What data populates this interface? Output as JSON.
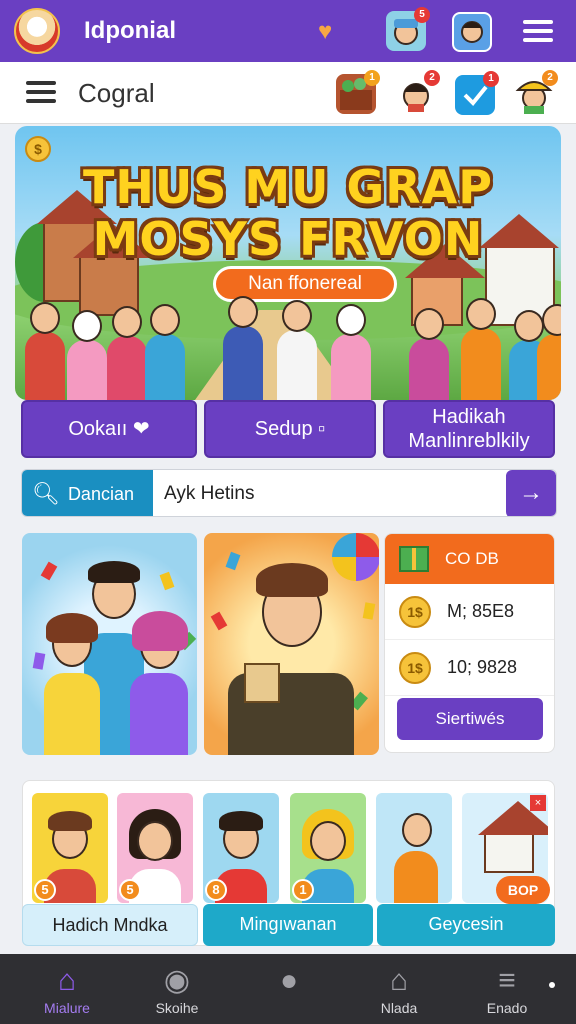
{
  "appbar": {
    "app_name": "Idponial",
    "notif_badge": "5"
  },
  "subbar": {
    "title": "Cogral",
    "badges": [
      "1",
      "2",
      "1",
      "2"
    ]
  },
  "hero": {
    "title_line1": "THUS MU GRAP",
    "title_line2": "MOSYS FRVON",
    "pill_label": "Nan ffonereal"
  },
  "actions": [
    {
      "label": "Ookaıı ❤"
    },
    {
      "label": "Sedup ▫"
    },
    {
      "label": "Hadikah Manlinreblkily"
    }
  ],
  "search": {
    "tab_label": "Dancian",
    "value": "Ayk Hetins",
    "go_icon": "→"
  },
  "reward": {
    "header": "CO DB",
    "rows": [
      {
        "coin": "1$",
        "text": "M; 85E8"
      },
      {
        "coin": "1$",
        "text": "10; 9828"
      }
    ],
    "button": "Siertiwés"
  },
  "thumbs": {
    "numbers": [
      "5",
      "5",
      "8",
      "1"
    ],
    "close": "×",
    "bop": "BOP"
  },
  "categories": [
    {
      "label": "Hadich Mndka"
    },
    {
      "label": "Mingıwanan"
    },
    {
      "label": "Geycesin"
    }
  ],
  "bottom_nav": [
    {
      "label": "Mialure",
      "active": true
    },
    {
      "label": "Skoihe"
    },
    {
      "label": ""
    },
    {
      "label": "Nlada"
    },
    {
      "label": "Enado"
    }
  ],
  "colors": {
    "primary": "#6a3fc2",
    "accent": "#f26b1d",
    "teal": "#1a8fc1",
    "nav_bg": "#2f2f33"
  }
}
